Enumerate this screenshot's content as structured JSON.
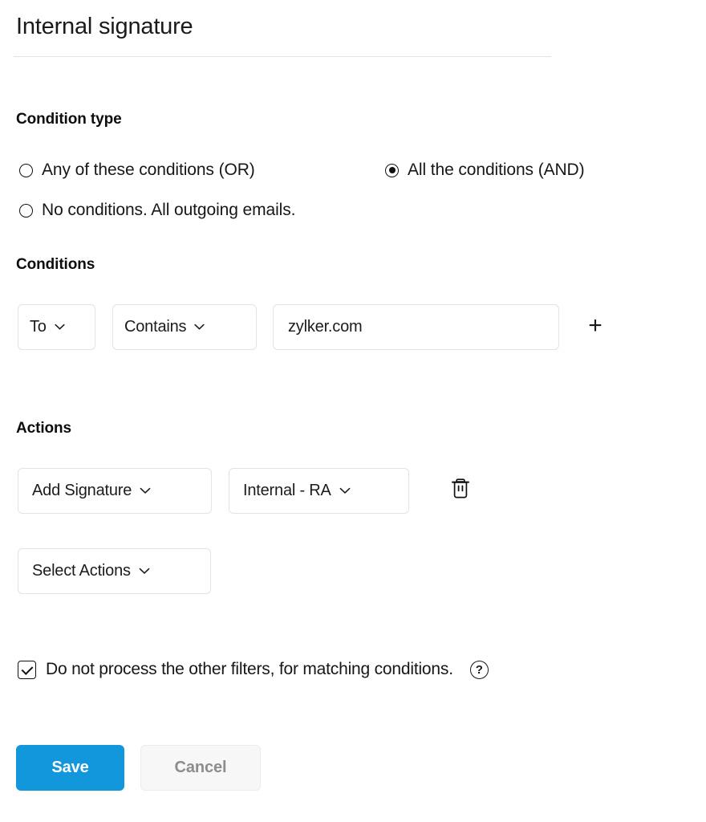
{
  "header": {
    "title": "Internal signature"
  },
  "condition_type": {
    "heading": "Condition type",
    "options": [
      {
        "label": "Any of these conditions (OR)",
        "selected": false
      },
      {
        "label": "All the conditions (AND)",
        "selected": true
      },
      {
        "label": "No conditions. All outgoing emails.",
        "selected": false
      }
    ]
  },
  "conditions": {
    "heading": "Conditions",
    "row": {
      "field": "To",
      "operator": "Contains",
      "value": "zylker.com",
      "add_label": "+"
    }
  },
  "actions": {
    "heading": "Actions",
    "row": {
      "action_type": "Add Signature",
      "action_value": "Internal - RA",
      "delete_icon": "trash-icon"
    },
    "select_actions": "Select Actions"
  },
  "filter_option": {
    "label": "Do not process the other filters, for matching conditions.",
    "checked": true,
    "help_icon": "?"
  },
  "footer": {
    "save_label": "Save",
    "cancel_label": "Cancel"
  },
  "colors": {
    "save_background": "#1296dc",
    "cancel_background": "#f7f7f8",
    "cancel_text": "#8d8d8d",
    "border": "#e3e3e3",
    "divider": "#e4e4e4"
  }
}
